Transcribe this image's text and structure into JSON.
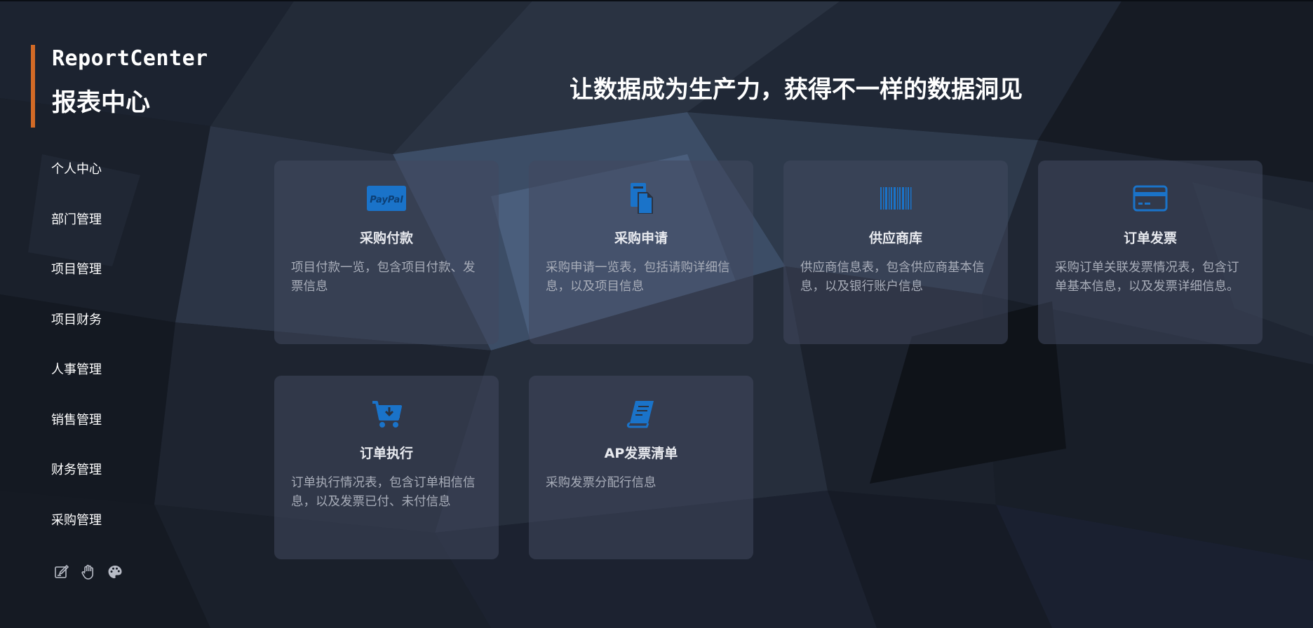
{
  "brand": {
    "name_en": "ReportCenter",
    "name_cn": "报表中心"
  },
  "nav": {
    "items": [
      "个人中心",
      "部门管理",
      "项目管理",
      "项目财务",
      "人事管理",
      "销售管理",
      "财务管理",
      "采购管理"
    ]
  },
  "tools": [
    "edit-icon",
    "hand-icon",
    "palette-icon"
  ],
  "headline": "让数据成为生产力，获得不一样的数据洞见",
  "colors": {
    "accent": "#d26a26",
    "icon_blue": "#1a73c9",
    "card_bg": "#3a4055"
  },
  "cards": [
    {
      "icon": "paypal-icon",
      "title": "采购付款",
      "desc": "项目付款一览，包含项目付款、发票信息"
    },
    {
      "icon": "document-icon",
      "title": "采购申请",
      "desc": "采购申请一览表，包括请购详细信息，以及项目信息"
    },
    {
      "icon": "barcode-icon",
      "title": "供应商库",
      "desc": "供应商信息表，包含供应商基本信息，以及银行账户信息"
    },
    {
      "icon": "credit-card-icon",
      "title": "订单发票",
      "desc": "采购订单关联发票情况表，包含订单基本信息，以及发票详细信息。"
    },
    {
      "icon": "cart-icon",
      "title": "订单执行",
      "desc": "订单执行情况表，包含订单相信信息，以及发票已付、未付信息"
    },
    {
      "icon": "book-icon",
      "title": "AP发票清单",
      "desc": "采购发票分配行信息"
    }
  ]
}
